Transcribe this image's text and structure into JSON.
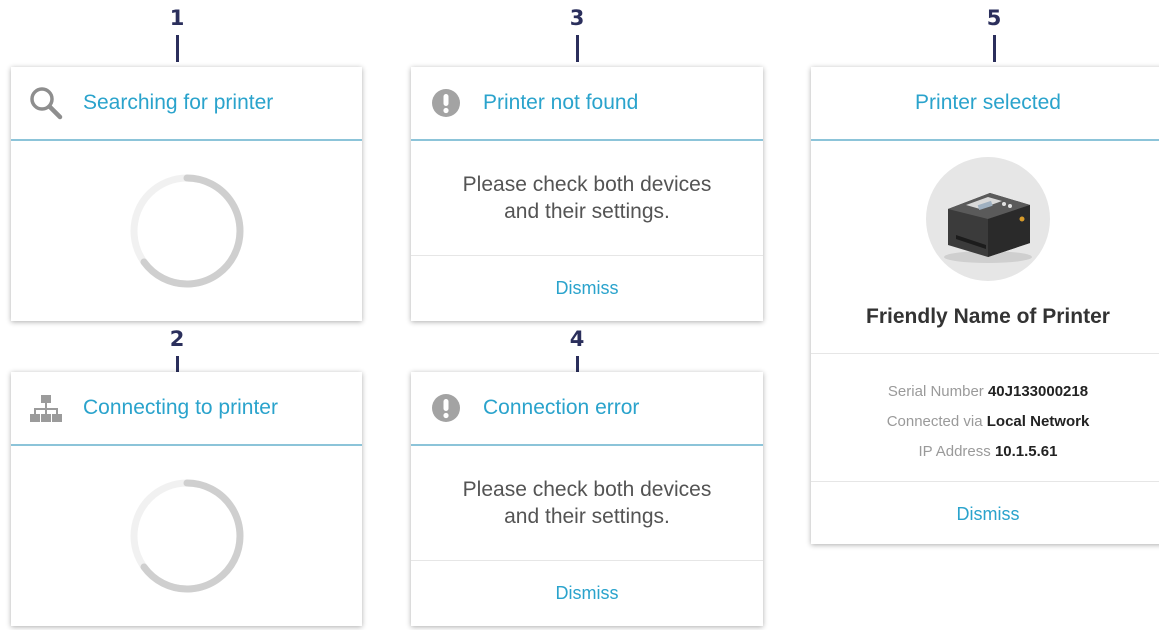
{
  "callouts": [
    "1",
    "2",
    "3",
    "4",
    "5"
  ],
  "colors": {
    "accent": "#2aa3cc",
    "divider": "#8cc4d9",
    "callout": "#2b2f5c"
  },
  "cards": {
    "searching": {
      "title": "Searching for printer",
      "icon": "search-icon"
    },
    "connecting": {
      "title": "Connecting to printer",
      "icon": "network-icon"
    },
    "not_found": {
      "title": "Printer not found",
      "icon": "alert-icon",
      "message_line1": "Please check both devices",
      "message_line2": "and their settings.",
      "dismiss": "Dismiss"
    },
    "connection_error": {
      "title": "Connection error",
      "icon": "alert-icon",
      "message_line1": "Please check both devices",
      "message_line2": "and their settings.",
      "dismiss": "Dismiss"
    },
    "selected": {
      "title": "Printer selected",
      "printer_name": "Friendly Name of Printer",
      "serial_label": "Serial Number",
      "serial_value": "40J133000218",
      "connected_label": "Connected via",
      "connected_value": "Local Network",
      "ip_label": "IP Address",
      "ip_value": "10.1.5.61",
      "dismiss": "Dismiss"
    }
  }
}
